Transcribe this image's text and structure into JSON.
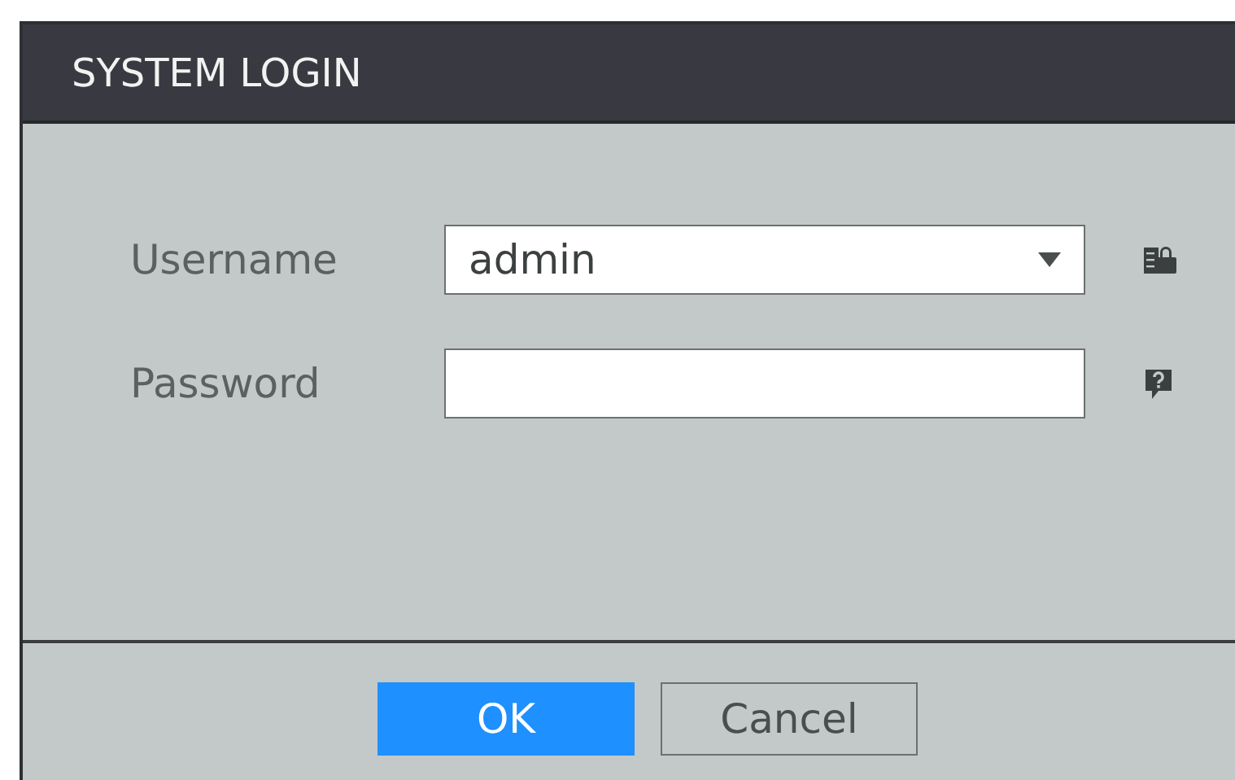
{
  "window": {
    "title": "SYSTEM LOGIN"
  },
  "fields": [
    {
      "label": "Username",
      "kind": "dropdown",
      "value": "admin"
    },
    {
      "label": "Password",
      "kind": "password"
    }
  ],
  "buttons": [
    {
      "label": "OK",
      "selected": true
    },
    {
      "label": "Cancel",
      "selected": false
    }
  ]
}
